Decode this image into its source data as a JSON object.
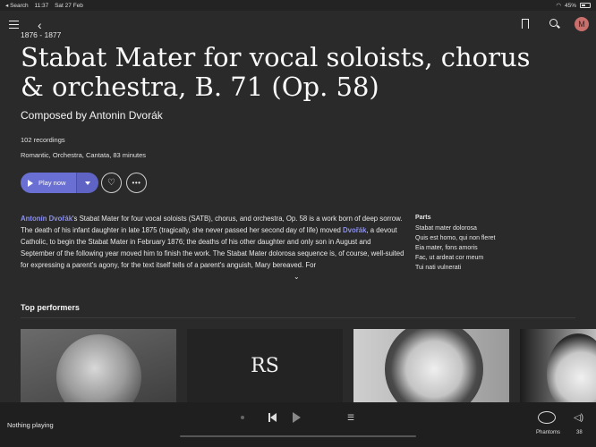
{
  "status_bar": {
    "back_label": "◂ Search",
    "time": "11:37",
    "date": "Sat 27 Feb",
    "battery": "45%"
  },
  "header": {
    "avatar_letter": "M"
  },
  "work": {
    "years": "1876 - 1877",
    "title": "Stabat Mater for vocal soloists, chorus & orchestra, B. 71 (Op. 58)",
    "composer": "Composed by Antonin Dvorák",
    "recordings": "102 recordings",
    "genres": "Romantic, Orchestra, Cantata, 83 minutes"
  },
  "actions": {
    "play_label": "Play now",
    "more_label": "•••"
  },
  "description": {
    "composer_link": "Antonín Dvořák",
    "text1": "'s Stabat Mater for four vocal soloists (SATB), chorus, and orchestra, Op. 58 is a work born of deep sorrow. The death of his infant daughter in late 1875 (tragically, she never passed her second day of life) moved ",
    "link2": "Dvořák",
    "text2": ", a devout Catholic, to begin the Stabat Mater in February 1876; the deaths of his other daughter and only son in August and September of the following year moved him to finish the work. The Stabat Mater dolorosa sequence is, of course, well-suited for expressing a parent's agony, for the text itself tells of a parent's anguish, Mary bereaved. For"
  },
  "parts": {
    "heading": "Parts",
    "items": [
      "Stabat mater dolorosa",
      "Quis est homo, qui non fleret",
      "Eia mater, fons amoris",
      "Fac, ut ardeat cor meum",
      "Tui nati vulnerati"
    ]
  },
  "performers": {
    "heading": "Top performers",
    "initials": "RS"
  },
  "player": {
    "status": "Nothing playing",
    "output_label": "Phantoms",
    "volume": "38"
  }
}
